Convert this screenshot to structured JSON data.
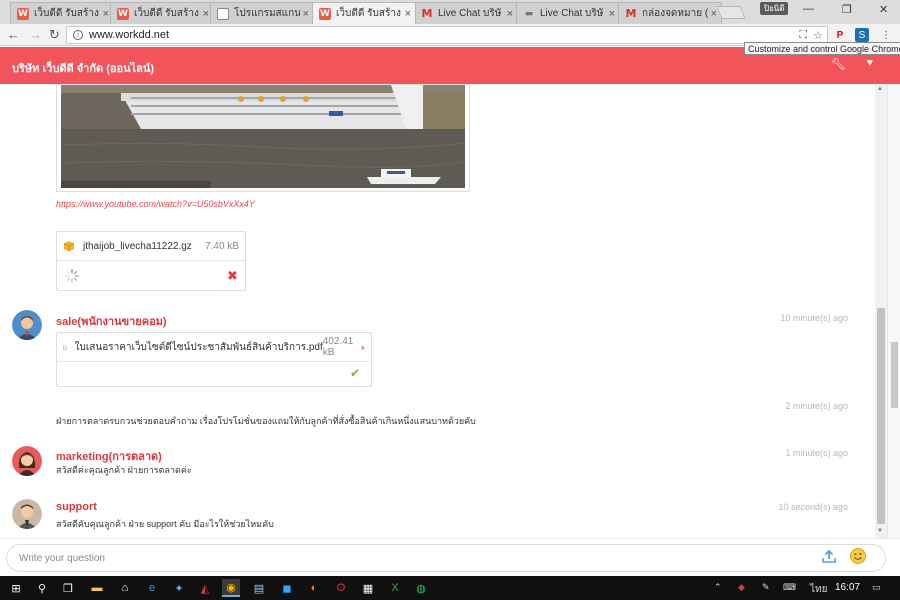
{
  "browser": {
    "tabs": [
      {
        "title": "เว็บดีดี รับสร้าง",
        "icon": "workdd-favicon-icon",
        "active": false
      },
      {
        "title": "เว็บดีดี รับสร้าง",
        "icon": "workdd-favicon-icon",
        "active": false
      },
      {
        "title": "โปรแกรมสแกนเ",
        "icon": "program-favicon-icon",
        "active": false
      },
      {
        "title": "เว็บดีดี รับสร้าง",
        "icon": "workdd-favicon-icon",
        "active": true
      },
      {
        "title": "Live Chat บริษั",
        "icon": "gmail-icon",
        "active": false
      },
      {
        "title": "Live Chat บริษั",
        "icon": "chat-favicon-icon",
        "active": false
      },
      {
        "title": "กล่องจดหมาย (9",
        "icon": "gmail-icon",
        "active": false
      }
    ],
    "favicon_letter": "W",
    "profile": "ปิยนิดี",
    "url": "www.workdd.net",
    "tooltip": "Customize and control Google Chrome"
  },
  "chat": {
    "company": "บริษัท เว็บดีดี จำกัด (ออนไลน์)",
    "youtube_link": "https://www.youtube.com/watch?v=U50sbVxXx4Y",
    "attachment1": {
      "name": "jthaijob_livecha11222.gz",
      "size": "7.40 kB"
    },
    "messages": [
      {
        "sender": "sale(พนักงานขายคอม)",
        "time": "10 minute(s) ago",
        "file": {
          "name": "ใบเสนอราคาเว็บไซต์ดีไซน์ประชาสัมพันธ์สินค้าบริการ.pdf",
          "size": "402.41 kB"
        }
      },
      {
        "sender": "",
        "time": "2 minute(s) ago",
        "text": "ฝ่ายการตลาดรบกวนช่วยตอบคำถาม เรื่องโปรโมชั่นของแถมให้กับลูกค้าที่สั่งซื้อสินค้าเกินหนึ่งแสนบาทด้วยคับ"
      },
      {
        "sender": "marketing(การตลาด)",
        "time": "1 minute(s) ago",
        "text": "สวัสดีค่ะคุณลูกค้า ฝ่ายการตลาดค่ะ"
      },
      {
        "sender": "support",
        "time": "10 second(s) ago",
        "text": "สวัสดีคับคุณลูกค้า ฝ่าย support คับ มีอะไรให้ช่วยไหมคับ"
      }
    ],
    "input_placeholder": "Write your question"
  },
  "taskbar": {
    "language": "ไทย",
    "clock": "16:07",
    "colors": {
      "accent": "#f2545b",
      "sender": "#d83a3f",
      "link": "#e8474f"
    }
  }
}
